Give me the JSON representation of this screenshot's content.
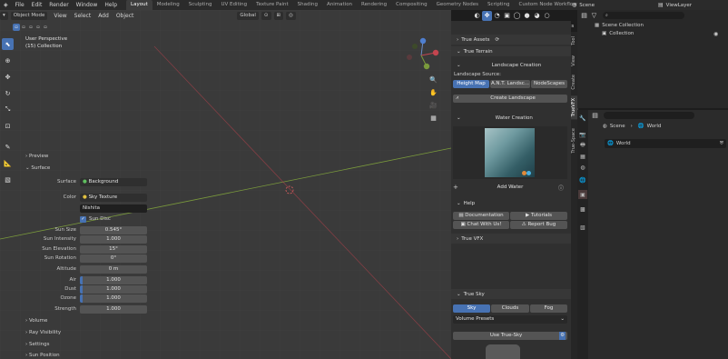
{
  "menu": [
    "File",
    "Edit",
    "Render",
    "Window",
    "Help"
  ],
  "workspaces": [
    "Layout",
    "Modeling",
    "Sculpting",
    "UV Editing",
    "Texture Paint",
    "Shading",
    "Animation",
    "Rendering",
    "Compositing",
    "Geometry Nodes",
    "Scripting",
    "Custom Node Workflow"
  ],
  "active_workspace": "Layout",
  "scene_label": "Scene",
  "viewlayer_label": "ViewLayer",
  "viewport": {
    "mode": "Object Mode",
    "menus": [
      "View",
      "Select",
      "Add",
      "Object"
    ],
    "orientation": "Global",
    "options": "Options",
    "perspective": "User Perspective",
    "collection": "(15) Collection"
  },
  "npanel": {
    "true_assets": "True Assets",
    "true_terrain": "True Terrain",
    "landscape_creation": "Landscape Creation",
    "landscape_source": "Landscape Source:",
    "sources": [
      "Height Map",
      "A.N.T. Landsc...",
      "NodeScapes"
    ],
    "create_landscape": "Create Landscape",
    "water_creation": "Water Creation",
    "add_water": "Add Water",
    "help": "Help",
    "help_buttons": [
      "Documentation",
      "Tutorials",
      "Chat With Us!",
      "Report Bug"
    ],
    "true_vfx": "True VFX",
    "true_sky": "True Sky",
    "sky_tabs": [
      "Sky",
      "Clouds",
      "Fog"
    ],
    "volume_presets": "Volume Presets",
    "use_true_sky": "Use True-Sky",
    "vertical_tabs": [
      "Tool",
      "View",
      "Create",
      "TrueVFX",
      "True-Space"
    ]
  },
  "outliner": {
    "scene_collection": "Scene Collection",
    "collection": "Collection"
  },
  "properties": {
    "breadcrumb_scene": "Scene",
    "breadcrumb_world": "World",
    "world_name": "World",
    "sections": {
      "preview": "Preview",
      "surface": "Surface",
      "volume": "Volume",
      "ray_visibility": "Ray Visibility",
      "settings": "Settings",
      "sun_position": "Sun Position"
    },
    "surface_label": "Surface",
    "surface_value": "Background",
    "color_label": "Color",
    "color_value": "Sky Texture",
    "sky_type": "Nishita",
    "sun_disc": "Sun Disc",
    "fields": [
      {
        "label": "Sun Size",
        "value": "0.545°"
      },
      {
        "label": "Sun Intensity",
        "value": "1.000"
      },
      {
        "label": "Sun Elevation",
        "value": "15°"
      },
      {
        "label": "Sun Rotation",
        "value": "0°"
      },
      {
        "label": "Altitude",
        "value": "0 m"
      },
      {
        "label": "Air",
        "value": "1.000"
      },
      {
        "label": "Dust",
        "value": "1.000"
      },
      {
        "label": "Ozone",
        "value": "1.000"
      },
      {
        "label": "Strength",
        "value": "1.000"
      }
    ]
  },
  "colors": {
    "accent": "#4772b3",
    "x_axis": "#a14049",
    "y_axis": "#7a9a3c"
  }
}
